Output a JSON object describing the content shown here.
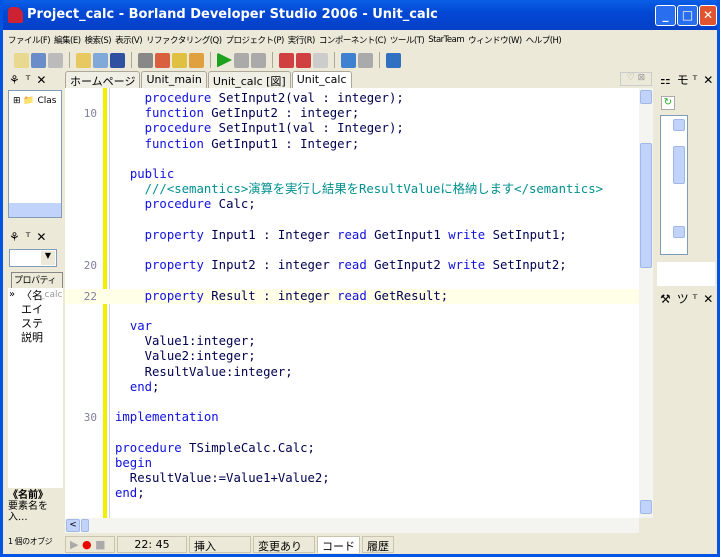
{
  "window": {
    "title": "Project_calc - Borland Developer Studio 2006 - Unit_calc",
    "min": "_",
    "max": "□",
    "close": "✕"
  },
  "menu": [
    "ファイル(F)",
    "編集(E)",
    "検索(S)",
    "表示(V)",
    "リファクタリング(Q)",
    "プロジェクト(P)",
    "実行(R)",
    "コンポーネント(C)",
    "ツール(T)",
    "StarTeam",
    "ウィンドウ(W)",
    "ヘルプ(H)"
  ],
  "tabs": [
    "ホームページ",
    "Unit_main",
    "Unit_calc [図]",
    "Unit_calc"
  ],
  "structure": {
    "item": "Clas",
    "pin": "ᵀ",
    "close": "✕"
  },
  "inspector": {
    "tab": "プロパティ",
    "expand": "»",
    "rows": [
      "〈名",
      "エイ",
      "ステ",
      "説明"
    ],
    "value": "_calc",
    "desc_title": "《名前》",
    "desc_text": "要素名を入...",
    "status": "1 個のオブジ"
  },
  "right_panel": {
    "pin": "モ ᵀ",
    "close": "✕",
    "pin2": "ツ ᵀ"
  },
  "code": [
    {
      "n": "",
      "s": [
        [
          "    "
        ],
        [
          "procedure",
          "kw"
        ],
        [
          " SetInput2(val : integer);"
        ]
      ]
    },
    {
      "n": "10",
      "s": [
        [
          "    "
        ],
        [
          "function",
          "kw"
        ],
        [
          " GetInput2 : integer;"
        ]
      ]
    },
    {
      "n": "",
      "s": [
        [
          "    "
        ],
        [
          "procedure",
          "kw"
        ],
        [
          " SetInput1(val : Integer);"
        ]
      ]
    },
    {
      "n": "",
      "s": [
        [
          "    "
        ],
        [
          "function",
          "kw"
        ],
        [
          " GetInput1 : Integer;"
        ]
      ]
    },
    {
      "n": "",
      "s": [
        [
          ""
        ]
      ]
    },
    {
      "n": "",
      "s": [
        [
          "  "
        ],
        [
          "public",
          "kw"
        ]
      ]
    },
    {
      "n": "",
      "s": [
        [
          "    "
        ],
        [
          "///<semantics>演算を実行し結果をResultValueに格納します</semantics>",
          "cm"
        ]
      ]
    },
    {
      "n": "",
      "s": [
        [
          "    "
        ],
        [
          "procedure",
          "kw"
        ],
        [
          " Calc;"
        ]
      ]
    },
    {
      "n": "",
      "s": [
        [
          ""
        ]
      ]
    },
    {
      "n": "",
      "s": [
        [
          "    "
        ],
        [
          "property",
          "kw"
        ],
        [
          " Input1 : Integer "
        ],
        [
          "read",
          "kw"
        ],
        [
          " GetInput1 "
        ],
        [
          "write",
          "kw"
        ],
        [
          " SetInput1;"
        ]
      ]
    },
    {
      "n": "",
      "s": [
        [
          ""
        ]
      ]
    },
    {
      "n": "20",
      "s": [
        [
          "    "
        ],
        [
          "property",
          "kw"
        ],
        [
          " Input2 : integer "
        ],
        [
          "read",
          "kw"
        ],
        [
          " GetInput2 "
        ],
        [
          "write",
          "kw"
        ],
        [
          " SetInput2;"
        ]
      ]
    },
    {
      "n": "",
      "s": [
        [
          ""
        ]
      ]
    },
    {
      "n": "22",
      "cur": true,
      "s": [
        [
          "    "
        ],
        [
          "property",
          "kw"
        ],
        [
          " Result : integer "
        ],
        [
          "read",
          "kw"
        ],
        [
          " GetResult;"
        ]
      ]
    },
    {
      "n": "",
      "s": [
        [
          ""
        ]
      ]
    },
    {
      "n": "",
      "s": [
        [
          "  "
        ],
        [
          "var",
          "kw"
        ]
      ]
    },
    {
      "n": "",
      "s": [
        [
          "    Value1:integer;"
        ]
      ]
    },
    {
      "n": "",
      "s": [
        [
          "    Value2:integer;"
        ]
      ]
    },
    {
      "n": "",
      "s": [
        [
          "    ResultValue:integer;"
        ]
      ]
    },
    {
      "n": "",
      "s": [
        [
          "  "
        ],
        [
          "end",
          "kw"
        ],
        [
          ";"
        ]
      ]
    },
    {
      "n": "",
      "s": [
        [
          ""
        ]
      ]
    },
    {
      "n": "30",
      "s": [
        [
          "implementation",
          "kw"
        ]
      ]
    },
    {
      "n": "",
      "s": [
        [
          ""
        ]
      ]
    },
    {
      "n": "",
      "s": [
        [
          "procedure",
          "kw"
        ],
        [
          " TSimpleCalc.Calc;"
        ]
      ]
    },
    {
      "n": "",
      "s": [
        [
          "begin",
          "kw"
        ]
      ]
    },
    {
      "n": "",
      "s": [
        [
          "  ResultValue:=Value1+Value2;"
        ]
      ]
    },
    {
      "n": "",
      "s": [
        [
          "end",
          "kw"
        ],
        [
          ";"
        ]
      ]
    },
    {
      "n": "",
      "s": [
        [
          ""
        ]
      ]
    }
  ],
  "status": {
    "position": "22: 45",
    "mode": "挿入",
    "modified": "変更あり",
    "tab_code": "コード",
    "tab_history": "履歴"
  },
  "colors": {
    "keyword": "#1010e0",
    "comment": "#009090",
    "title": "#0348d4"
  }
}
